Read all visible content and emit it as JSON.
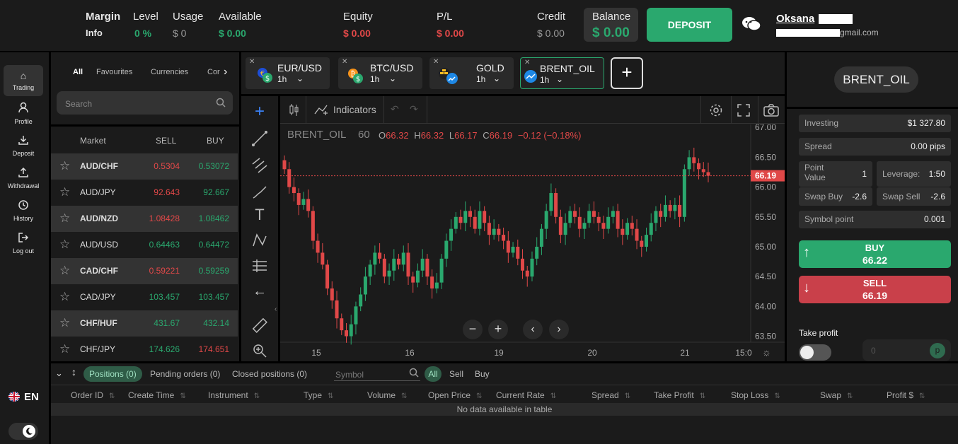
{
  "header": {
    "margin_label_1": "Margin",
    "margin_label_2": "Info",
    "level_label": "Level",
    "level_value": "0 %",
    "usage_label": "Usage",
    "usage_value": "$ 0",
    "available_label": "Available",
    "available_value": "$ 0.00",
    "equity_label": "Equity",
    "equity_value": "$ 0.00",
    "pl_label": "P/L",
    "pl_value": "$ 0.00",
    "credit_label": "Credit",
    "credit_value": "$ 0.00",
    "balance_label": "Balance",
    "balance_value": "$ 0.00",
    "deposit_label": "DEPOSIT",
    "user_name": "Oksana",
    "user_email": "gmail.com"
  },
  "sidebar": {
    "items": [
      {
        "label": "Trading",
        "icon": "home-icon"
      },
      {
        "label": "Profile",
        "icon": "user-icon"
      },
      {
        "label": "Deposit",
        "icon": "download-icon"
      },
      {
        "label": "Withdrawal",
        "icon": "upload-icon"
      },
      {
        "label": "History",
        "icon": "clock-icon"
      },
      {
        "label": "Log out",
        "icon": "logout-icon"
      }
    ],
    "language": "EN"
  },
  "markets": {
    "tabs": [
      "All",
      "Favourites",
      "Currencies",
      "Cor"
    ],
    "search_placeholder": "Search",
    "col_market": "Market",
    "col_sell": "SELL",
    "col_buy": "BUY",
    "rows": [
      {
        "name": "AUD/CHF",
        "sell": "0.5304",
        "buy": "0.53072"
      },
      {
        "name": "AUD/JPY",
        "sell": "92.643",
        "buy": "92.667"
      },
      {
        "name": "AUD/NZD",
        "sell": "1.08428",
        "buy": "1.08462"
      },
      {
        "name": "AUD/USD",
        "sell": "0.64463",
        "buy": "0.64472"
      },
      {
        "name": "CAD/CHF",
        "sell": "0.59221",
        "buy": "0.59259"
      },
      {
        "name": "CAD/JPY",
        "sell": "103.457",
        "buy": "103.457"
      },
      {
        "name": "CHF/HUF",
        "sell": "431.67",
        "buy": "432.14"
      },
      {
        "name": "CHF/JPY",
        "sell": "174.626",
        "buy": "174.651"
      }
    ]
  },
  "instrument_tabs": [
    {
      "name": "EUR/USD",
      "tf": "1h"
    },
    {
      "name": "BTC/USD",
      "tf": "1h"
    },
    {
      "name": "GOLD",
      "tf": "1h"
    },
    {
      "name": "BRENT_OIL",
      "tf": "1h"
    }
  ],
  "chart": {
    "toolbar_indicators": "Indicators",
    "symbol": "BRENT_OIL",
    "interval": "60",
    "o_label": "O",
    "o": "66.32",
    "h_label": "H",
    "h": "66.32",
    "l_label": "L",
    "l": "66.17",
    "c_label": "C",
    "c": "66.19",
    "change": "−0.12 (−0.18%)",
    "last_price": "66.19"
  },
  "chart_data": {
    "type": "candlestick",
    "x_ticks": [
      "15",
      "16",
      "19",
      "20",
      "21",
      "15:0"
    ],
    "y_ticks": [
      "67.00",
      "66.50",
      "66.00",
      "65.50",
      "65.00",
      "64.50",
      "64.00",
      "63.50"
    ],
    "ylim": [
      63.4,
      67.05
    ],
    "up_color": "#2aa86e",
    "down_color": "#e04848",
    "close_series": [
      66.3,
      66.0,
      65.9,
      65.7,
      65.8,
      65.6,
      65.1,
      64.9,
      64.7,
      64.3,
      64.1,
      63.8,
      63.6,
      63.5,
      63.7,
      64.0,
      64.2,
      64.5,
      64.7,
      64.9,
      64.8,
      64.5,
      64.6,
      64.8,
      64.7,
      64.9,
      64.5,
      64.4,
      64.6,
      64.8,
      64.5,
      64.3,
      64.4,
      64.8,
      65.1,
      65.3,
      65.5,
      65.4,
      65.6,
      65.5,
      65.3,
      65.6,
      65.4,
      65.2,
      65.3,
      65.2,
      65.1,
      64.9,
      65.0,
      64.8,
      64.6,
      64.5,
      64.8,
      65.0,
      65.3,
      65.6,
      65.9,
      65.5,
      65.2,
      65.4,
      65.6,
      65.5,
      65.3,
      65.4,
      65.6,
      65.5,
      65.4,
      65.3,
      65.5,
      65.6,
      65.3,
      65.2,
      65.4,
      65.3,
      65.1,
      65.0,
      65.2,
      65.4,
      65.6,
      65.5,
      65.7,
      65.6,
      65.7,
      65.5,
      66.3,
      66.5,
      66.4,
      66.3,
      66.25,
      66.19
    ]
  },
  "right_panel": {
    "symbol": "BRENT_OIL",
    "investing_label": "Investing",
    "investing_value": "$1 327.80",
    "spread_label": "Spread",
    "spread_value": "0.00 pips",
    "point_label": "Point Value",
    "point_value": "1",
    "leverage_label": "Leverage:",
    "leverage_value": "1:50",
    "swap_buy_label": "Swap Buy",
    "swap_buy_value": "-2.6",
    "swap_sell_label": "Swap Sell",
    "swap_sell_value": "-2.6",
    "symbol_point_label": "Symbol point",
    "symbol_point_value": "0.001",
    "buy_label": "BUY",
    "buy_price": "66.22",
    "sell_label": "SELL",
    "sell_price": "66.19",
    "take_profit_label": "Take profit",
    "tp_input": "0",
    "tp_unit": "p"
  },
  "bottom": {
    "tabs": [
      "Positions (0)",
      "Pending orders (0)",
      "Closed positions (0)"
    ],
    "symbol_placeholder": "Symbol",
    "filters": [
      "All",
      "Sell",
      "Buy"
    ],
    "columns": [
      "Order ID",
      "Create Time",
      "Instrument",
      "Type",
      "Volume",
      "Open Price",
      "Current Rate",
      "Spread",
      "Take Profit",
      "Stop Loss",
      "Swap",
      "Profit $"
    ],
    "empty_text": "No data available in table"
  }
}
